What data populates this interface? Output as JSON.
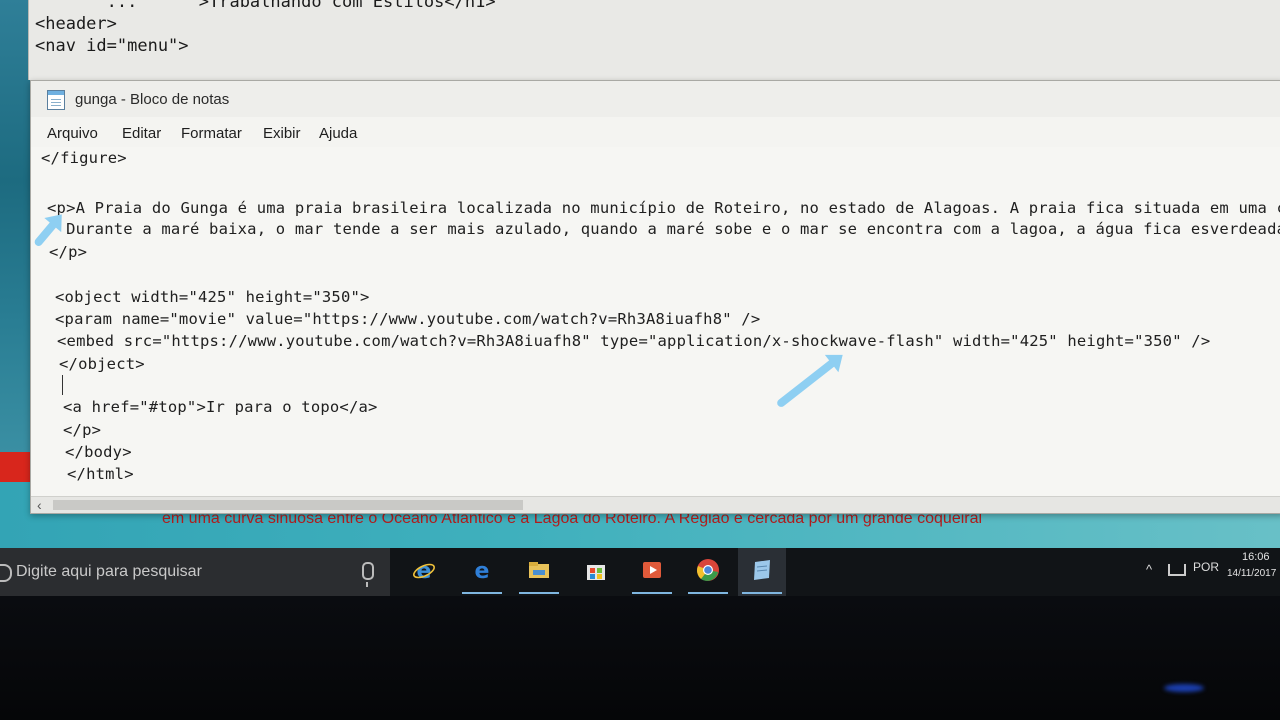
{
  "back_window": {
    "lines": [
      "       ...      >Trabalhando com Estilos</h1>",
      "<header>",
      "<nav id=\"menu\">"
    ]
  },
  "notepad": {
    "title": "gunga - Bloco de notas",
    "menu": [
      "Arquivo",
      "Editar",
      "Formatar",
      "Exibir",
      "Ajuda"
    ],
    "code_lines": [
      "</figure>",
      "",
      "<p>A Praia do Gunga é uma praia brasileira localizada no município de Roteiro, no estado de Alagoas. A praia fica situada em uma c",
      "  Durante a maré baixa, o mar tende a ser mais azulado, quando a maré sobe e o mar se encontra com a lagoa, a água fica esverdeada",
      "</p>",
      "",
      "<object width=\"425\" height=\"350\">",
      "<param name=\"movie\" value=\"https://www.youtube.com/watch?v=Rh3A8iuafh8\" />",
      "<embed src=\"https://www.youtube.com/watch?v=Rh3A8iuafh8\" type=\"application/x-shockwave-flash\" width=\"425\" height=\"350\" />",
      "</object>",
      "",
      "<a href=\"#top\">Ir para o topo</a>",
      "</p>",
      "</body>",
      "</html>"
    ]
  },
  "background_page_text": "em uma curva sinuosa entre o Oceano Atlântico e a Lagoa do Roteiro. A Região é cercada por um grande coqueiral",
  "taskbar": {
    "search_placeholder": "Digite aqui para pesquisar",
    "apps": [
      {
        "icon": "internet-explorer-icon",
        "color": "#3d8fd6"
      },
      {
        "icon": "edge-icon",
        "color": "#2f7fd8"
      },
      {
        "icon": "file-explorer-icon",
        "color": "#e8c25a"
      },
      {
        "icon": "store-icon",
        "color": "#e6e6e6"
      },
      {
        "icon": "media-player-icon",
        "color": "#e05a3a"
      },
      {
        "icon": "chrome-icon",
        "color": "#d9453a"
      },
      {
        "icon": "notepad-icon",
        "color": "#9cc8ea"
      }
    ],
    "tray": {
      "chevron": "^",
      "language": "POR",
      "time": "16:06",
      "date": "14/11/2017"
    }
  }
}
